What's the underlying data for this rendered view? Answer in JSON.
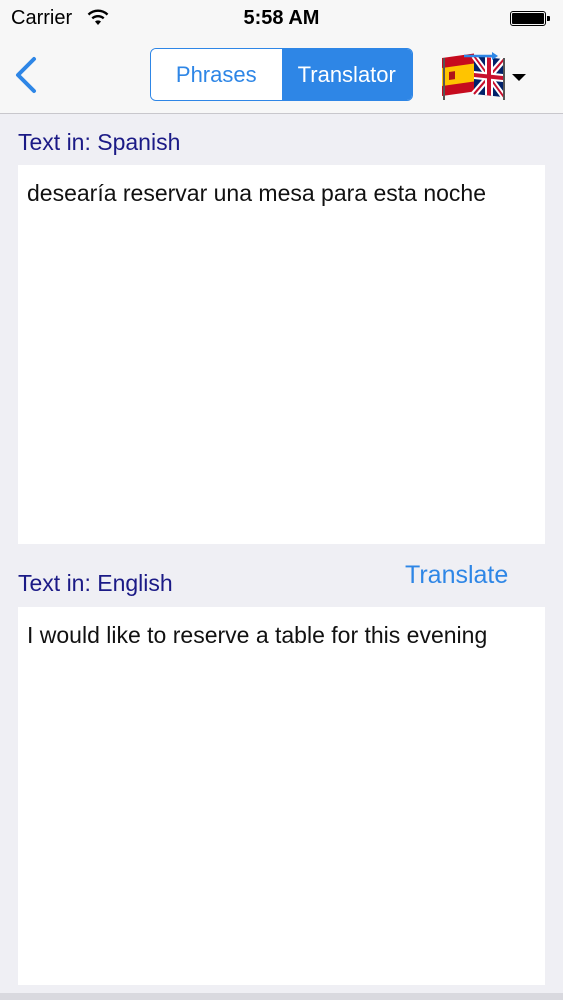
{
  "status_bar": {
    "carrier": "Carrier",
    "time": "5:58 AM",
    "wifi_icon": "wifi-icon",
    "battery_icon": "battery-icon"
  },
  "nav": {
    "back_icon": "chevron-left-icon",
    "segments": [
      {
        "label": "Phrases",
        "selected": false
      },
      {
        "label": "Translator",
        "selected": true
      }
    ],
    "language_selector_icon": "spain-uk-flags-icon",
    "dropdown_icon": "caret-down-icon"
  },
  "source": {
    "label": "Text in: Spanish",
    "text": "desearía reservar una mesa para esta noche"
  },
  "target": {
    "label": "Text in: English",
    "translate_label": "Translate",
    "text": "I would like to reserve a table for this evening"
  },
  "colors": {
    "accent": "#2e86e6",
    "label": "#1b1a86",
    "background": "#efeff4"
  }
}
